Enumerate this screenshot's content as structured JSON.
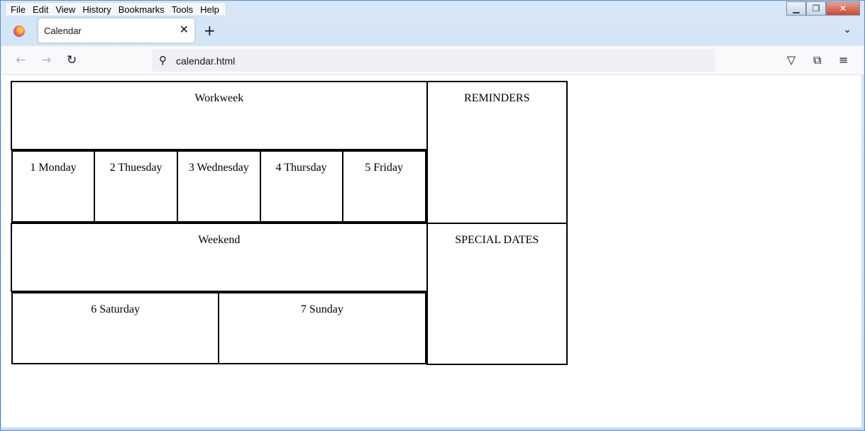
{
  "menu": [
    "File",
    "Edit",
    "View",
    "History",
    "Bookmarks",
    "Tools",
    "Help"
  ],
  "window_controls": {
    "minimize": "▁",
    "maximize": "❐",
    "close": "✕"
  },
  "tab": {
    "title": "Calendar",
    "close": "✕",
    "new_tab": "+",
    "list_all": "⌄"
  },
  "nav": {
    "back": "←",
    "forward": "→",
    "reload": "↻",
    "search_icon": "⚲",
    "url": "calendar.html",
    "pocket": "▽",
    "extensions": "⧉",
    "menu": "≡"
  },
  "calendar": {
    "workweek_header": "Workweek",
    "reminders": "REMINDERS",
    "workdays": [
      "1 Monday",
      "2 Thuesday",
      "3 Wednesday",
      "4 Thursday",
      "5 Friday"
    ],
    "weekend_header": "Weekend",
    "special_dates": "SPECIAL DATES",
    "weekend_days": [
      "6 Saturday",
      "7 Sunday"
    ]
  }
}
